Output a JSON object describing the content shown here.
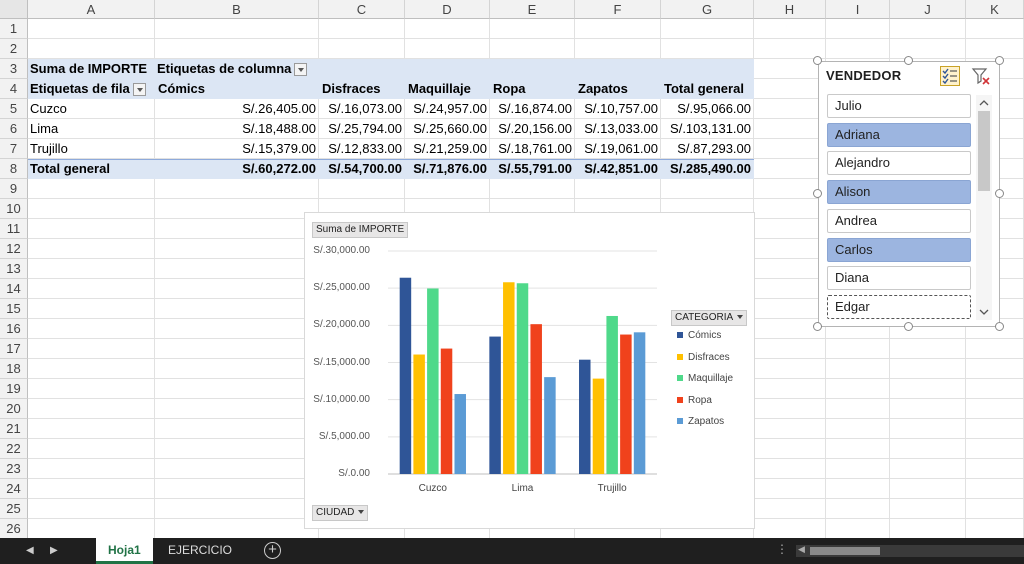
{
  "columns": [
    "A",
    "B",
    "C",
    "D",
    "E",
    "F",
    "G",
    "H",
    "I",
    "J",
    "K"
  ],
  "rows": [
    "1",
    "2",
    "3",
    "4",
    "5",
    "6",
    "7",
    "8",
    "9",
    "10",
    "11",
    "12",
    "13",
    "14",
    "15",
    "16",
    "17",
    "18",
    "19",
    "20",
    "21",
    "22",
    "23",
    "24",
    "25",
    "26"
  ],
  "pivot": {
    "values_label": "Suma de IMPORTE",
    "column_labels": "Etiquetas de columna",
    "row_labels": "Etiquetas de fila",
    "headers": [
      "Cómics",
      "Disfraces",
      "Maquillaje",
      "Ropa",
      "Zapatos",
      "Total general"
    ],
    "rows": [
      {
        "label": "Cuzco",
        "values": [
          "S/.26,405.00",
          "S/.16,073.00",
          "S/.24,957.00",
          "S/.16,874.00",
          "S/.10,757.00",
          "S/.95,066.00"
        ]
      },
      {
        "label": "Lima",
        "values": [
          "S/.18,488.00",
          "S/.25,794.00",
          "S/.25,660.00",
          "S/.20,156.00",
          "S/.13,033.00",
          "S/.103,131.00"
        ]
      },
      {
        "label": "Trujillo",
        "values": [
          "S/.15,379.00",
          "S/.12,833.00",
          "S/.21,259.00",
          "S/.18,761.00",
          "S/.19,061.00",
          "S/.87,293.00"
        ]
      }
    ],
    "total": {
      "label": "Total general",
      "values": [
        "S/.60,272.00",
        "S/.54,700.00",
        "S/.71,876.00",
        "S/.55,791.00",
        "S/.42,851.00",
        "S/.285,490.00"
      ]
    }
  },
  "chart_data": {
    "type": "bar",
    "title": "",
    "value_field": "Suma de IMPORTE",
    "axis_field": "CIUDAD",
    "legend_field": "CATEGORIA",
    "categories": [
      "Cuzco",
      "Lima",
      "Trujillo"
    ],
    "series": [
      {
        "name": "Cómics",
        "color": "#2f5597",
        "values": [
          26405,
          18488,
          15379
        ]
      },
      {
        "name": "Disfraces",
        "color": "#ffc000",
        "values": [
          16073,
          25794,
          12833
        ]
      },
      {
        "name": "Maquillaje",
        "color": "#4fd98a",
        "values": [
          24957,
          25660,
          21259
        ]
      },
      {
        "name": "Ropa",
        "color": "#f0421c",
        "values": [
          16874,
          20156,
          18761
        ]
      },
      {
        "name": "Zapatos",
        "color": "#5b9bd5",
        "values": [
          10757,
          13033,
          19061
        ]
      }
    ],
    "yticks": [
      "S/.0.00",
      "S/.5,000.00",
      "S/.10,000.00",
      "S/.15,000.00",
      "S/.20,000.00",
      "S/.25,000.00",
      "S/.30,000.00"
    ],
    "ylim": [
      0,
      30000
    ],
    "grid": true,
    "legend_position": "right"
  },
  "slicer": {
    "title": "VENDEDOR",
    "items": [
      {
        "label": "Julio",
        "selected": false
      },
      {
        "label": "Adriana",
        "selected": true
      },
      {
        "label": "Alejandro",
        "selected": false
      },
      {
        "label": "Alison",
        "selected": true
      },
      {
        "label": "Andrea",
        "selected": false
      },
      {
        "label": "Carlos",
        "selected": true
      },
      {
        "label": "Diana",
        "selected": false
      },
      {
        "label": "Edgar",
        "selected": false
      }
    ]
  },
  "sheets": [
    {
      "label": "Hoja1",
      "active": true
    },
    {
      "label": "EJERCICIO",
      "active": false
    }
  ],
  "icons": {
    "multiselect": "multi-select-icon",
    "clear_filter": "clear-filter-icon",
    "add_sheet": "add-sheet-icon"
  }
}
